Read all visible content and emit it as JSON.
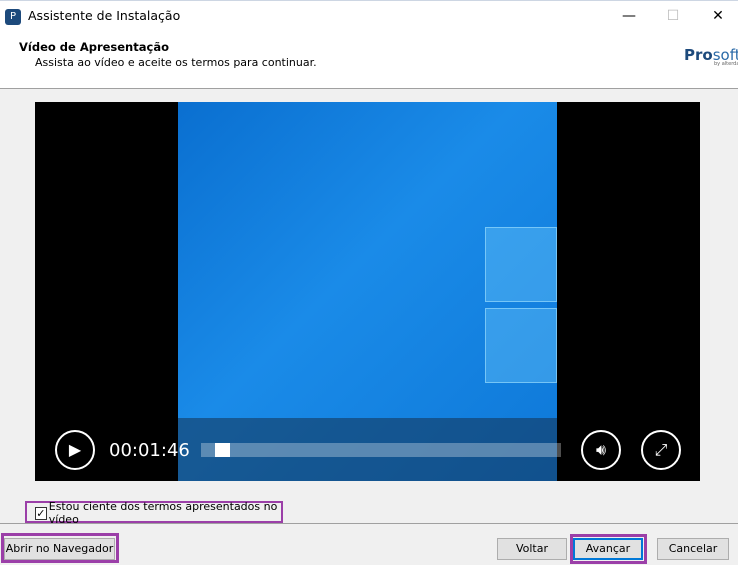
{
  "window": {
    "title": "Assistente de Instalação",
    "minimize": "—",
    "maximize": "☐",
    "close": "✕"
  },
  "header": {
    "title": "Vídeo de Apresentação",
    "subtitle": "Assista ao vídeo e aceite os termos para continuar.",
    "logo": "Prosoft by alterdata"
  },
  "video": {
    "time": "00:01:46",
    "progress": 0.04,
    "play_icon": "play-icon",
    "volume_icon": "volume-icon",
    "fullscreen_icon": "fullscreen-icon"
  },
  "terms": {
    "label": "Estou ciente dos termos apresentados no vídeo",
    "checked": true
  },
  "buttons": {
    "browser": "Abrir no Navegador",
    "back": "Voltar",
    "next": "Avançar",
    "cancel": "Cancelar"
  },
  "colors": {
    "highlight": "#9b3fa8",
    "focus": "#0078d7"
  }
}
